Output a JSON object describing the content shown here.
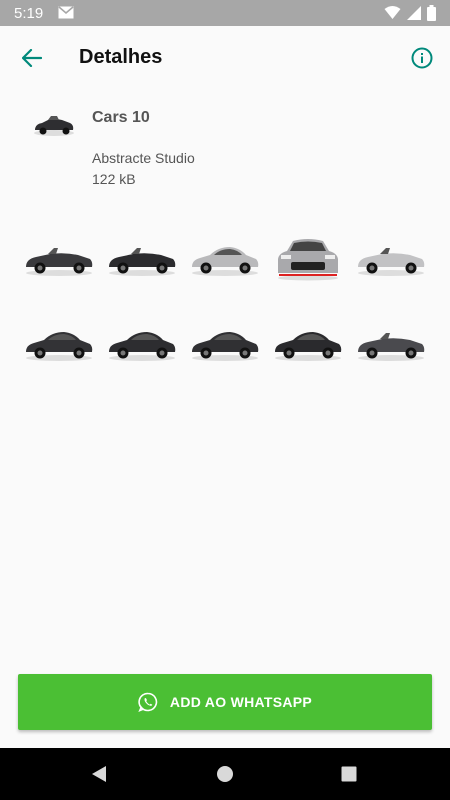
{
  "status_bar": {
    "time": "5:19"
  },
  "app_bar": {
    "title": "Detalhes"
  },
  "pack": {
    "name": "Cars 10",
    "publisher": "Abstracte Studio",
    "size": "122 kB"
  },
  "stickers": [
    {
      "color": "#3a3a3d",
      "style": "roadster"
    },
    {
      "color": "#2b2b2e",
      "style": "roadster"
    },
    {
      "color": "#b9b9bb",
      "style": "coupe"
    },
    {
      "color": "#a9a9ac",
      "style": "front"
    },
    {
      "color": "#c2c2c4",
      "style": "roadster"
    },
    {
      "color": "#333336",
      "style": "coupe"
    },
    {
      "color": "#2d2d30",
      "style": "coupe"
    },
    {
      "color": "#303033",
      "style": "coupe"
    },
    {
      "color": "#2a2a2d",
      "style": "coupe"
    },
    {
      "color": "#4a4a4e",
      "style": "roadster"
    }
  ],
  "add_button": {
    "label": "ADD AO WHATSAPP"
  },
  "colors": {
    "accent": "#00897b",
    "button": "#4bbf34",
    "status_bar": "#a7a7a7"
  }
}
